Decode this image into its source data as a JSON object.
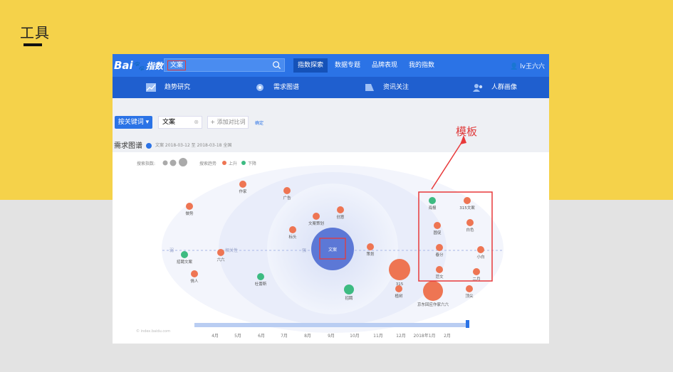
{
  "slide": {
    "title": "工具"
  },
  "annotation": {
    "label": "模板",
    "color": "#e03a3a"
  },
  "topbar": {
    "logo_text": "Bai",
    "logo_paw": "du",
    "logo_suffix": "指数",
    "search_value": "文案",
    "nav": [
      "指数探索",
      "数据专题",
      "品牌表现",
      "我的指数"
    ],
    "user": "lv王六六"
  },
  "subnav": [
    "趋势研究",
    "需求图谱",
    "资讯关注",
    "人群画像"
  ],
  "toolbar": {
    "keyword_button": "按关键词",
    "keyword_value": "文案",
    "add_compare": "+ 添加对比词",
    "confirm": "确定",
    "section_title": "需求图谱",
    "section_meta": "文案   2018-03-12 至 2018-03-18   全国"
  },
  "legend": {
    "search_index": "搜索指数:",
    "search_trend": "搜索趋势",
    "up": "上升",
    "down": "下降"
  },
  "graph": {
    "center": "文案",
    "nodes": [
      {
        "label": "作家",
        "trend": "up"
      },
      {
        "label": "广告",
        "trend": "up"
      },
      {
        "label": "做势",
        "trend": "up"
      },
      {
        "label": "创意",
        "trend": "up"
      },
      {
        "label": "文案策划",
        "trend": "up"
      },
      {
        "label": "标头",
        "trend": "up"
      },
      {
        "label": "招聘文案",
        "trend": "down"
      },
      {
        "label": "六六",
        "trend": "up"
      },
      {
        "label": "策划",
        "trend": "up"
      },
      {
        "label": "情人",
        "trend": "up"
      },
      {
        "label": "杜蕾斯",
        "trend": "down"
      },
      {
        "label": "招聘",
        "trend": "down"
      },
      {
        "label": "315",
        "trend": "up"
      },
      {
        "label": "植树",
        "trend": "up"
      },
      {
        "label": "京东回应作家六六",
        "trend": "up"
      },
      {
        "label": "海报",
        "trend": "down"
      },
      {
        "label": "315文案",
        "trend": "up"
      },
      {
        "label": "圆促",
        "trend": "up"
      },
      {
        "label": "白色",
        "trend": "up"
      },
      {
        "label": "春分",
        "trend": "up"
      },
      {
        "label": "小白",
        "trend": "up"
      },
      {
        "label": "范文",
        "trend": "up"
      },
      {
        "label": "二月",
        "trend": "up"
      },
      {
        "label": "顶尖",
        "trend": "up"
      }
    ],
    "axis_left": "相关性",
    "axis_low": "弱",
    "axis_high": "强",
    "timeline": [
      "4月",
      "5月",
      "6月",
      "7月",
      "8月",
      "9月",
      "10月",
      "11月",
      "12月",
      "2018年1月",
      "2月"
    ],
    "watermark": "© index.baidu.com",
    "colors": {
      "up": "#ee7553",
      "down": "#3dbb82",
      "center": "#5c78d6"
    }
  }
}
